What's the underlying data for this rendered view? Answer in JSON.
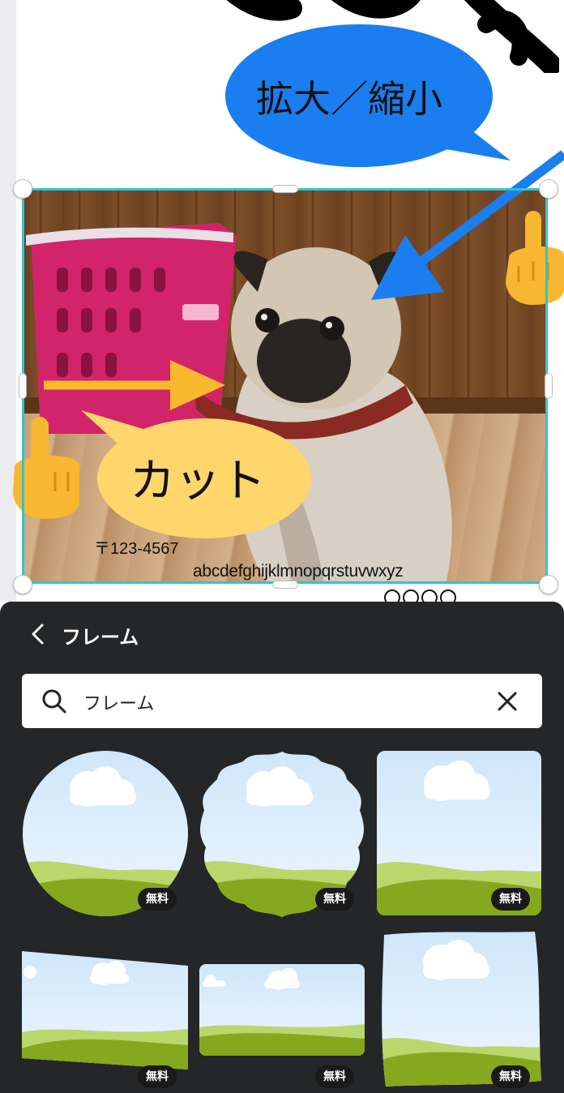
{
  "canvas": {
    "bubble_blue_text": "拡大／縮小",
    "bubble_yellow_text": "カット",
    "postal_text": "〒123-4567",
    "alphabet_text": "abcdefghijklmnopqrstuvwxyz",
    "colors": {
      "blue_bubble": "#1a7ef0",
      "yellow_bubble": "#ffd66b",
      "arrow_yellow": "#f9b92d",
      "selection": "#2ec5d3"
    },
    "icons": [
      "pointing-finger-icon",
      "arrow-icon"
    ]
  },
  "panel": {
    "title": "フレーム",
    "search": {
      "value": "フレーム",
      "placeholder": ""
    },
    "icons": [
      "chevron-left-icon",
      "search-icon",
      "close-icon"
    ],
    "frames": [
      {
        "shape": "circle",
        "badge": "無料"
      },
      {
        "shape": "scalloped",
        "badge": "無料"
      },
      {
        "shape": "rounded-rectangle",
        "badge": "無料"
      },
      {
        "shape": "skewed",
        "badge": "無料"
      },
      {
        "shape": "rectangle",
        "badge": "無料"
      },
      {
        "shape": "wavy-square",
        "badge": "無料"
      }
    ]
  }
}
